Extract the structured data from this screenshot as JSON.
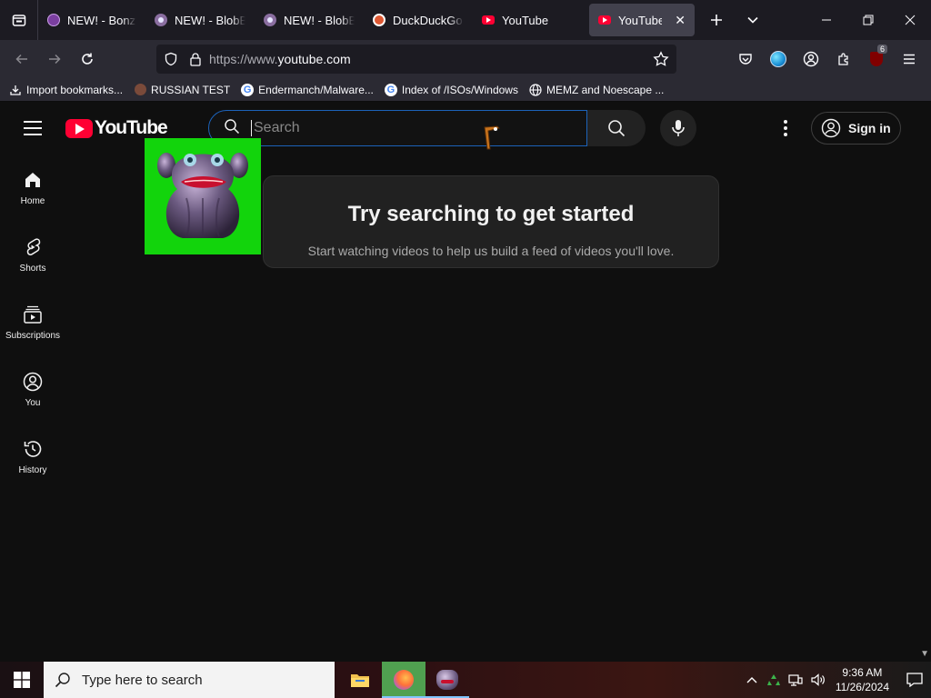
{
  "browser": {
    "tabs": [
      {
        "title": "NEW! - BonziBUDD",
        "favicon": "bonzi-icon",
        "active": false
      },
      {
        "title": "NEW! - BlobBl",
        "favicon": "blob-icon",
        "active": false
      },
      {
        "title": "NEW! - BlobBl",
        "favicon": "blob-icon",
        "active": false
      },
      {
        "title": "DuckDuckGo -",
        "favicon": "duckduckgo-icon",
        "active": false
      },
      {
        "title": "YouTube",
        "favicon": "youtube-icon",
        "active": false
      },
      {
        "title": "YouTube",
        "favicon": "youtube-icon",
        "active": true
      }
    ],
    "url": {
      "prefix": "https://www.",
      "domain": "youtube.com"
    },
    "extension_badge": "6",
    "bookmarks": [
      {
        "label": "Import bookmarks...",
        "icon": "import-icon"
      },
      {
        "label": "RUSSIAN TEST",
        "icon": "site-icon"
      },
      {
        "label": "Endermanch/Malware...",
        "icon": "google-icon"
      },
      {
        "label": "Index of /ISOs/Windows",
        "icon": "google-icon"
      },
      {
        "label": "MEMZ and Noescape ...",
        "icon": "globe-icon"
      }
    ]
  },
  "youtube": {
    "logo_text": "YouTube",
    "search": {
      "placeholder": "Search",
      "value": ""
    },
    "signin_label": "Sign in",
    "guide": [
      {
        "label": "Home",
        "icon": "home-icon"
      },
      {
        "label": "Shorts",
        "icon": "shorts-icon"
      },
      {
        "label": "Subscriptions",
        "icon": "subscriptions-icon"
      },
      {
        "label": "You",
        "icon": "you-icon"
      },
      {
        "label": "History",
        "icon": "history-icon"
      }
    ],
    "empty_state": {
      "title": "Try searching to get started",
      "subtitle": "Start watching videos to help us build a feed of videos you'll love."
    },
    "colors": {
      "brand_red": "#ff0033",
      "bg": "#0f0f0f",
      "card": "#212121"
    }
  },
  "taskbar": {
    "search_placeholder": "Type here to search",
    "time": "9:36 AM",
    "date": "11/26/2024"
  }
}
